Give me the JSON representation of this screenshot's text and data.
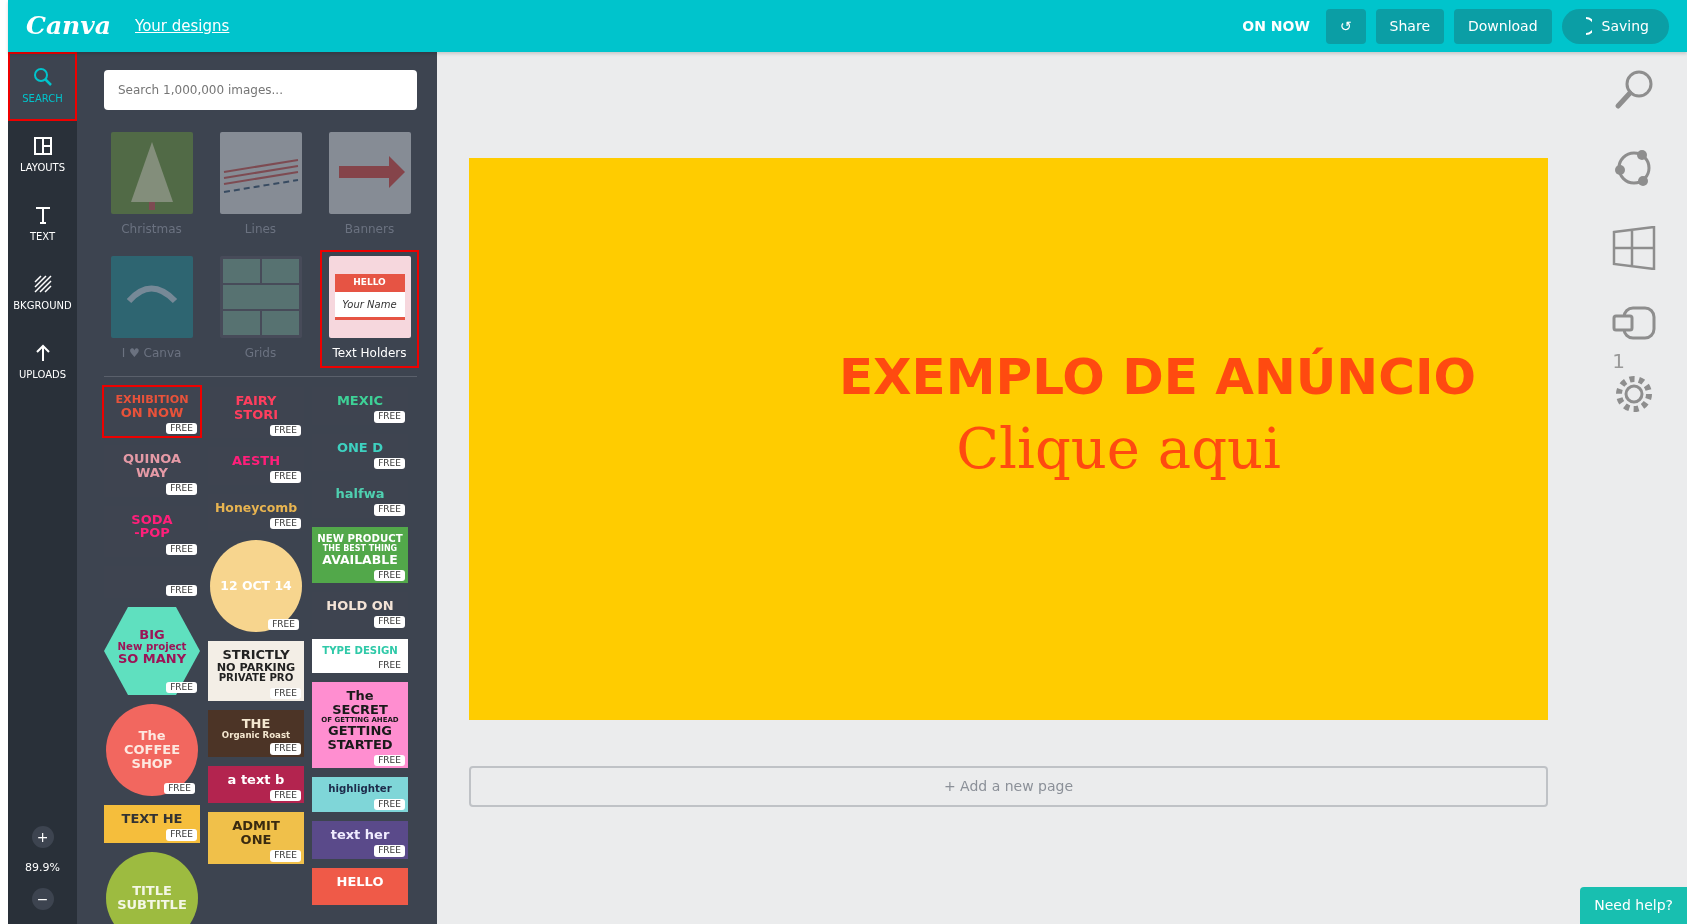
{
  "topbar": {
    "logo": "Canva",
    "link": "Your designs",
    "status": "ON NOW",
    "undo": "↺",
    "buttons": [
      "Share",
      "Download"
    ],
    "saving": "Saving"
  },
  "rail": {
    "items": [
      {
        "label": "SEARCH",
        "selected": true,
        "highlighted": true
      },
      {
        "label": "LAYOUTS",
        "selected": false,
        "highlighted": false
      },
      {
        "label": "TEXT",
        "selected": false,
        "highlighted": false
      },
      {
        "label": "BKGROUND",
        "selected": false,
        "highlighted": false
      },
      {
        "label": "UPLOADS",
        "selected": false,
        "highlighted": false
      }
    ],
    "zoom_in": "+",
    "zoom": "89.9%",
    "zoom_out": "−"
  },
  "panel": {
    "search": {
      "placeholder": "Search 1,000,000 images..."
    },
    "categories": [
      {
        "label": "Christmas",
        "kind": "tree",
        "selected": false,
        "highlighted": false
      },
      {
        "label": "Lines",
        "kind": "lines",
        "selected": false,
        "highlighted": false
      },
      {
        "label": "Banners",
        "kind": "banner",
        "selected": false,
        "highlighted": false
      },
      {
        "label": "I ♥ Canva",
        "kind": "badge",
        "selected": false,
        "highlighted": false
      },
      {
        "label": "Grids",
        "kind": "grid",
        "selected": false,
        "highlighted": false
      },
      {
        "label": "Text Holders",
        "kind": "nametag",
        "selected": true,
        "highlighted": true,
        "thumb_lines": [
          "HELLO",
          "Your Name"
        ]
      }
    ],
    "stickers": [
      [
        {
          "kind": "plain",
          "color": "#3e4450",
          "lines": [
            "EXHIBITION",
            "ON NOW"
          ],
          "free": "FREE",
          "highlighted": true
        },
        {
          "kind": "plain",
          "color": "#3e4450",
          "lines": [
            "QUINOA",
            "WAY"
          ],
          "free": "FREE",
          "highlighted": false
        },
        {
          "kind": "plain",
          "color": "#3e4450",
          "lines": [
            "SODA",
            "-POP"
          ],
          "free": "FREE",
          "highlighted": false
        },
        {
          "kind": "plain",
          "color": "#3e4450",
          "free": "FREE",
          "highlighted": false
        },
        {
          "kind": "hex",
          "color": "#5fe0bf",
          "lines": [
            "BIG",
            "New project",
            "SO MANY"
          ],
          "free": "FREE",
          "highlighted": false
        },
        {
          "kind": "circle",
          "color": "#f2675f",
          "lines": [
            "The",
            "COFFEE",
            "SHOP"
          ],
          "free": "FREE",
          "highlighted": false
        },
        {
          "kind": "rect",
          "color": "#f5be3c",
          "lines": [
            "TEXT HE"
          ],
          "free": "FREE",
          "highlighted": false
        },
        {
          "kind": "circle",
          "color": "#9dbb40",
          "lines": [
            "TITLE",
            "SUBTITLE"
          ],
          "highlighted": false
        }
      ],
      [
        {
          "kind": "plain",
          "color": "#3e4450",
          "lines": [
            "FAIRY",
            "STORI"
          ],
          "free": "FREE",
          "highlighted": false
        },
        {
          "kind": "plain",
          "color": "#3e4450",
          "lines": [
            "AESTH"
          ],
          "free": "FREE",
          "highlighted": false
        },
        {
          "kind": "plain",
          "color": "#3e4450",
          "lines": [
            "Honeycomb"
          ],
          "free": "FREE",
          "highlighted": false
        },
        {
          "kind": "circle",
          "color": "#f7d58e",
          "lines": [
            "12 OCT 14"
          ],
          "free": "FREE",
          "highlighted": false
        },
        {
          "kind": "rect",
          "color": "#f3eee6",
          "lines": [
            "STRICTLY",
            "NO PARKING",
            "PRIVATE PRO"
          ],
          "free": "FREE",
          "highlighted": false
        },
        {
          "kind": "rect",
          "color": "#4c3426",
          "lines": [
            "THE",
            "Organic Roast"
          ],
          "free": "FREE",
          "highlighted": false
        },
        {
          "kind": "rect",
          "color": "#b3244f",
          "lines": [
            "a text b"
          ],
          "free": "FREE",
          "highlighted": false
        },
        {
          "kind": "rect",
          "color": "#f0c04a",
          "lines": [
            "ADMIT",
            "ONE"
          ],
          "free": "FREE",
          "highlighted": false
        }
      ],
      [
        {
          "kind": "plain",
          "color": "#3e4450",
          "lines": [
            "MEXIC"
          ],
          "free": "FREE",
          "highlighted": false
        },
        {
          "kind": "plain",
          "color": "#3e4450",
          "lines": [
            "ONE D"
          ],
          "free": "FREE",
          "highlighted": false
        },
        {
          "kind": "plain",
          "color": "#3e4450",
          "lines": [
            "halfwa"
          ],
          "free": "FREE",
          "highlighted": false
        },
        {
          "kind": "rect",
          "color": "#52a84a",
          "lines": [
            "NEW PRODUCT",
            "THE BEST THING",
            "AVAILABLE"
          ],
          "free": "FREE",
          "highlighted": false
        },
        {
          "kind": "rect",
          "color": "#3e4450",
          "lines": [
            "HOLD ON"
          ],
          "free": "FREE",
          "highlighted": false
        },
        {
          "kind": "rect",
          "color": "#ffffff",
          "lines": [
            "TYPE DESIGN"
          ],
          "free": "FREE",
          "highlighted": false
        },
        {
          "kind": "rect",
          "color": "#ff8ed0",
          "lines": [
            "The",
            "SECRET",
            "OF GETTING AHEAD",
            "GETTING",
            "STARTED"
          ],
          "free": "FREE",
          "highlighted": false
        },
        {
          "kind": "rect",
          "color": "#7fd6d8",
          "lines": [
            "highlighter"
          ],
          "free": "FREE",
          "highlighted": false
        },
        {
          "kind": "rect",
          "color": "#5a4a8a",
          "lines": [
            "text her"
          ],
          "free": "FREE",
          "highlighted": false
        },
        {
          "kind": "rect",
          "color": "#ef5a48",
          "lines": [
            "HELLO"
          ],
          "highlighted": false
        }
      ]
    ]
  },
  "design": {
    "headline": "EXEMPLO DE ANÚNCIO",
    "subline": "Clique aqui"
  },
  "add_page": "+ Add a new page",
  "page_number": "1",
  "help": "Need help?"
}
